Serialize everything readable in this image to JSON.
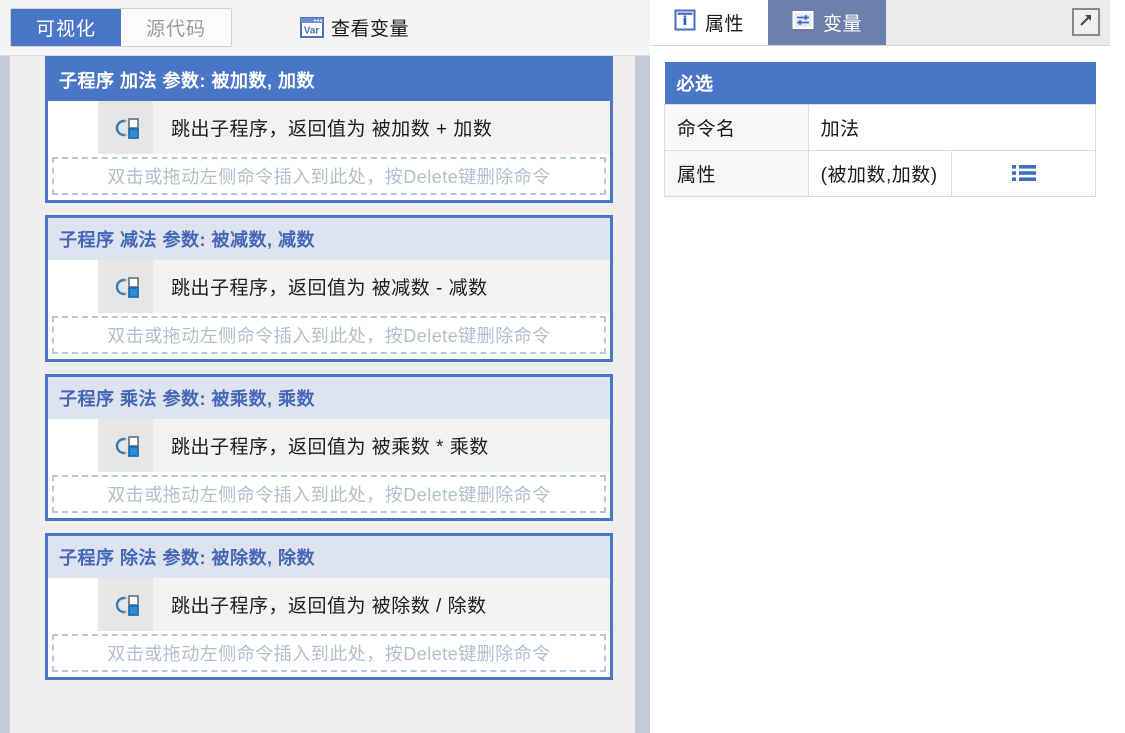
{
  "toolbar": {
    "tabs": [
      {
        "label": "可视化",
        "active": true
      },
      {
        "label": "源代码",
        "active": false
      }
    ],
    "view_variables": {
      "label": "查看变量",
      "icon": "var-window-icon"
    }
  },
  "editor": {
    "blocks": [
      {
        "header": "子程序 加法 参数: 被加数, 加数",
        "selected": true,
        "statement": {
          "icon": "jump-out-subroutine-icon",
          "text": "跳出子程序，返回值为 被加数 + 加数"
        },
        "dropzone": "双击或拖动左侧命令插入到此处，按Delete键删除命令"
      },
      {
        "header": "子程序 减法 参数: 被减数, 减数",
        "selected": false,
        "statement": {
          "icon": "jump-out-subroutine-icon",
          "text": "跳出子程序，返回值为 被减数 - 减数"
        },
        "dropzone": "双击或拖动左侧命令插入到此处，按Delete键删除命令"
      },
      {
        "header": "子程序 乘法 参数: 被乘数, 乘数",
        "selected": false,
        "statement": {
          "icon": "jump-out-subroutine-icon",
          "text": "跳出子程序，返回值为 被乘数 * 乘数"
        },
        "dropzone": "双击或拖动左侧命令插入到此处，按Delete键删除命令"
      },
      {
        "header": "子程序 除法 参数: 被除数, 除数",
        "selected": false,
        "statement": {
          "icon": "jump-out-subroutine-icon",
          "text": "跳出子程序，返回值为 被除数 / 除数"
        },
        "dropzone": "双击或拖动左侧命令插入到此处，按Delete键删除命令"
      }
    ]
  },
  "inspector": {
    "tabs": [
      {
        "label": "属性",
        "icon": "info-icon",
        "active": true
      },
      {
        "label": "变量",
        "icon": "variables-icon",
        "active": false
      }
    ],
    "expand_icon": "expand-arrow-icon",
    "group_title": "必选",
    "rows": [
      {
        "key": "命令名",
        "value": "加法",
        "has_button": false
      },
      {
        "key": "属性",
        "value": "(被加数,加数)",
        "has_button": true,
        "button_icon": "list-icon"
      }
    ]
  },
  "colors": {
    "accent_blue": "#4a76c8",
    "header_unselected": "#dde4f0",
    "header_unselected_text": "#4667b5",
    "tab_inactive_blue": "#6d80ab",
    "canvas_bg": "#eeeeee",
    "divider": "#c2cada"
  }
}
